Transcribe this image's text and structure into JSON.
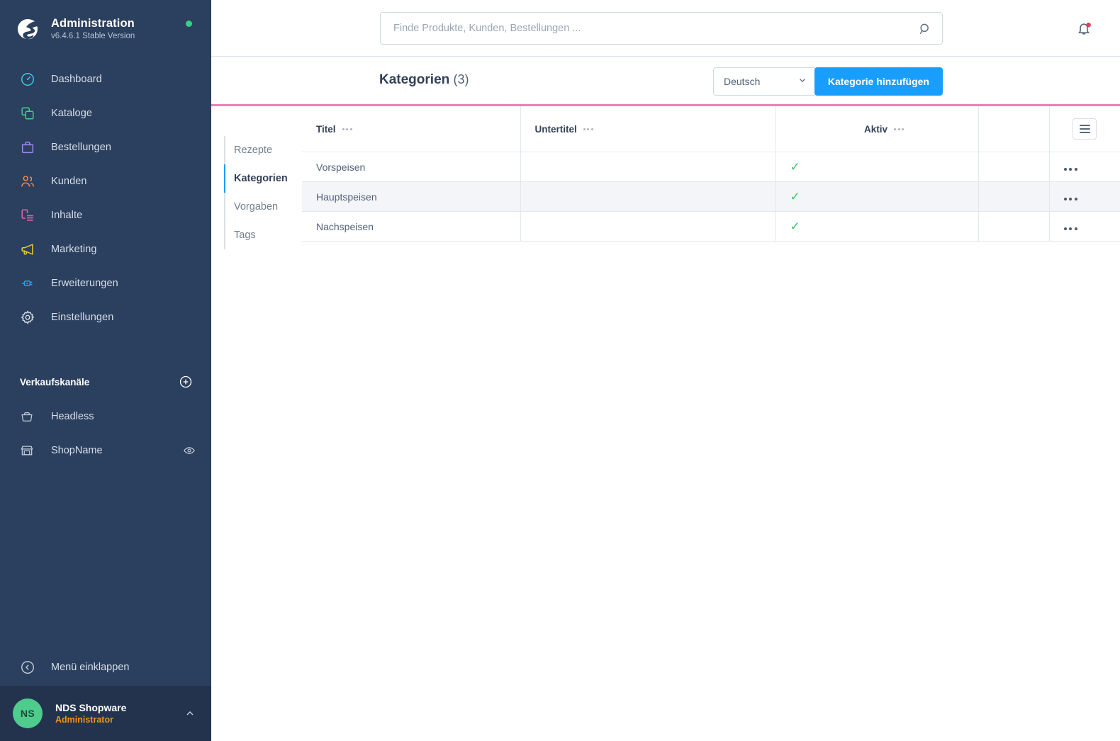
{
  "sidebar": {
    "app_title": "Administration",
    "version": "v6.4.6.1 Stable Version",
    "logo_icon": "shopware-logo-icon",
    "status_dot_color": "#37d183",
    "nav_items": [
      {
        "label": "Dashboard",
        "icon": "dashboard-gauge-icon",
        "color": "#3ec9e0"
      },
      {
        "label": "Kataloge",
        "icon": "catalog-copy-icon",
        "color": "#4ecb8d"
      },
      {
        "label": "Bestellungen",
        "icon": "orders-bag-icon",
        "color": "#a08bf0"
      },
      {
        "label": "Kunden",
        "icon": "customers-users-icon",
        "color": "#f58a5a"
      },
      {
        "label": "Inhalte",
        "icon": "content-page-icon",
        "color": "#ef62ad"
      },
      {
        "label": "Marketing",
        "icon": "marketing-megaphone-icon",
        "color": "#f2cb2b"
      },
      {
        "label": "Erweiterungen",
        "icon": "extensions-plug-icon",
        "color": "#2aa3f0"
      },
      {
        "label": "Einstellungen",
        "icon": "settings-gear-icon",
        "color": "#d6dce5"
      }
    ],
    "channels_title": "Verkaufskanäle",
    "add_channel_icon": "plus-circle-icon",
    "channels": [
      {
        "label": "Headless",
        "icon": "basket-icon",
        "trailing_icon": ""
      },
      {
        "label": "ShopName",
        "icon": "storefront-icon",
        "trailing_icon": "eye-icon"
      }
    ],
    "collapse_label": "Menü einklappen",
    "collapse_icon": "chevron-left-circle-icon",
    "user": {
      "initials": "NS",
      "name": "NDS Shopware",
      "role": "Administrator",
      "caret_icon": "chevron-up-icon",
      "avatar_color": "#4ecb8d",
      "role_color": "#eb9518"
    }
  },
  "topbar": {
    "search_placeholder": "Finde Produkte, Kunden, Bestellungen ...",
    "search_value": "",
    "search_icon": "search-icon",
    "bell_icon": "bell-icon",
    "bell_has_badge": true,
    "badge_color": "#e3405f"
  },
  "page_header": {
    "title": "Kategorien",
    "count": "(3)",
    "language": {
      "value": "Deutsch",
      "caret_icon": "chevron-down-icon"
    },
    "add_button": {
      "label": "Kategorie hinzufügen",
      "color": "#189eff"
    },
    "accent_line_color": "#ee7eb9"
  },
  "submenu": {
    "items": [
      {
        "label": "Rezepte",
        "active": false
      },
      {
        "label": "Kategorien",
        "active": true
      },
      {
        "label": "Vorgaben",
        "active": false
      },
      {
        "label": "Tags",
        "active": false
      }
    ]
  },
  "table": {
    "columns": [
      {
        "label": "Titel",
        "has_dots": true,
        "align": "left"
      },
      {
        "label": "Untertitel",
        "has_dots": true,
        "align": "left"
      },
      {
        "label": "Aktiv",
        "has_dots": true,
        "align": "center"
      },
      {
        "label": "",
        "has_dots": false,
        "align": "left"
      }
    ],
    "settings_icon": "table-settings-icon",
    "row_menu_icon": "more-horizontal-icon",
    "check_icon": "check-icon",
    "check_color": "#3ec264",
    "rows": [
      {
        "titel": "Vorspeisen",
        "untertitel": "",
        "aktiv": true,
        "blank": ""
      },
      {
        "titel": "Hauptspeisen",
        "untertitel": "",
        "aktiv": true,
        "blank": ""
      },
      {
        "titel": "Nachspeisen",
        "untertitel": "",
        "aktiv": true,
        "blank": ""
      }
    ]
  }
}
